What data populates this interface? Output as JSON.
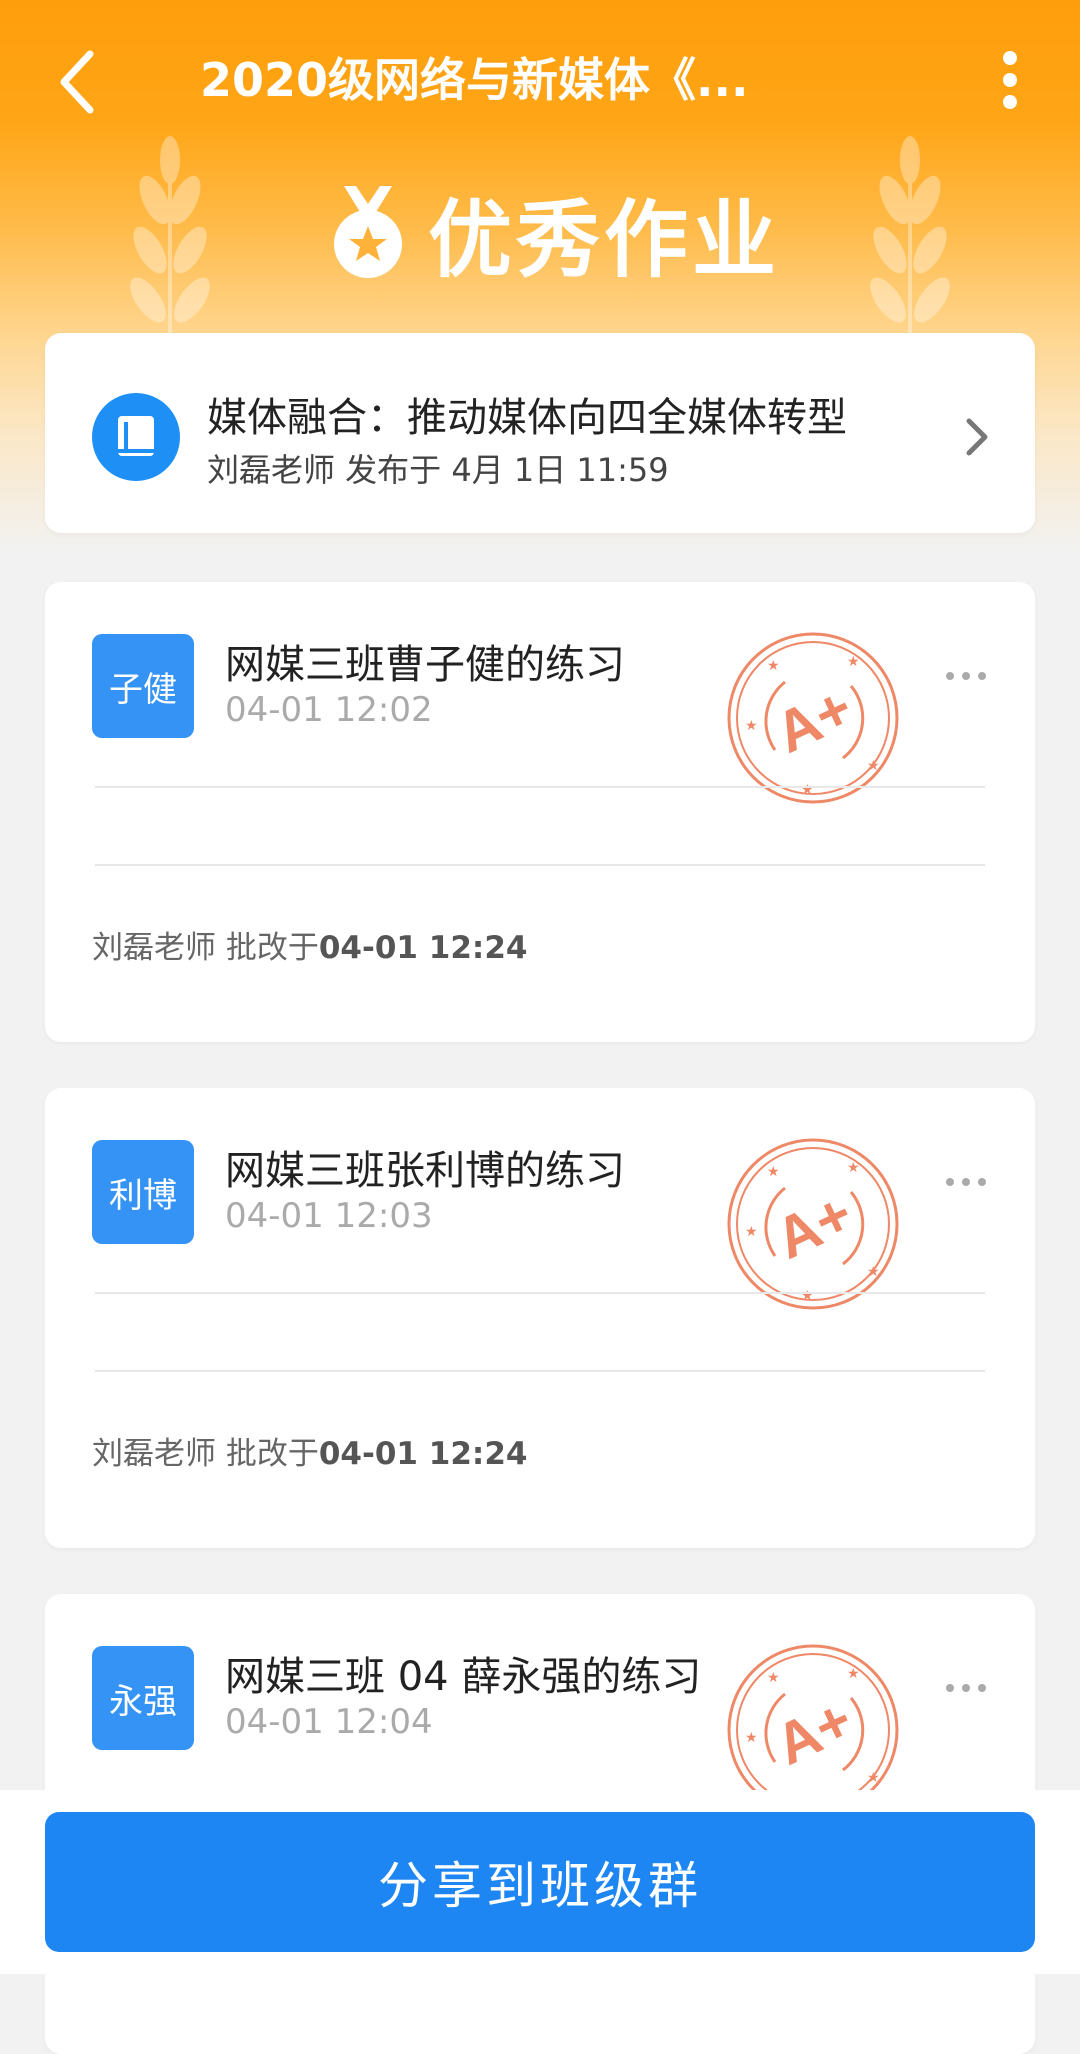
{
  "header": {
    "title": "2020级网络与新媒体《...",
    "banner_title": "优秀作业"
  },
  "assignment": {
    "title": "媒体融合：推动媒体向四全媒体转型",
    "meta": "刘磊老师 发布于 4月 1日 11:59"
  },
  "submissions": [
    {
      "avatar": "子健",
      "title": "网媒三班曹子健的练习",
      "time": "04-01 12:02",
      "grade": "A+",
      "graded_prefix": "刘磊老师 批改于",
      "graded_time": "04-01 12:24"
    },
    {
      "avatar": "利博",
      "title": "网媒三班张利博的练习",
      "time": "04-01 12:03",
      "grade": "A+",
      "graded_prefix": "刘磊老师 批改于",
      "graded_time": "04-01 12:24"
    },
    {
      "avatar": "永强",
      "title": "网媒三班 04 薛永强的练习",
      "time": "04-01 12:04",
      "grade": "A+"
    }
  ],
  "footer": {
    "share_label": "分享到班级群"
  },
  "colors": {
    "header_orange": "#ff9e0c",
    "primary_blue": "#1e86f2",
    "stamp_red": "#ee8866"
  }
}
